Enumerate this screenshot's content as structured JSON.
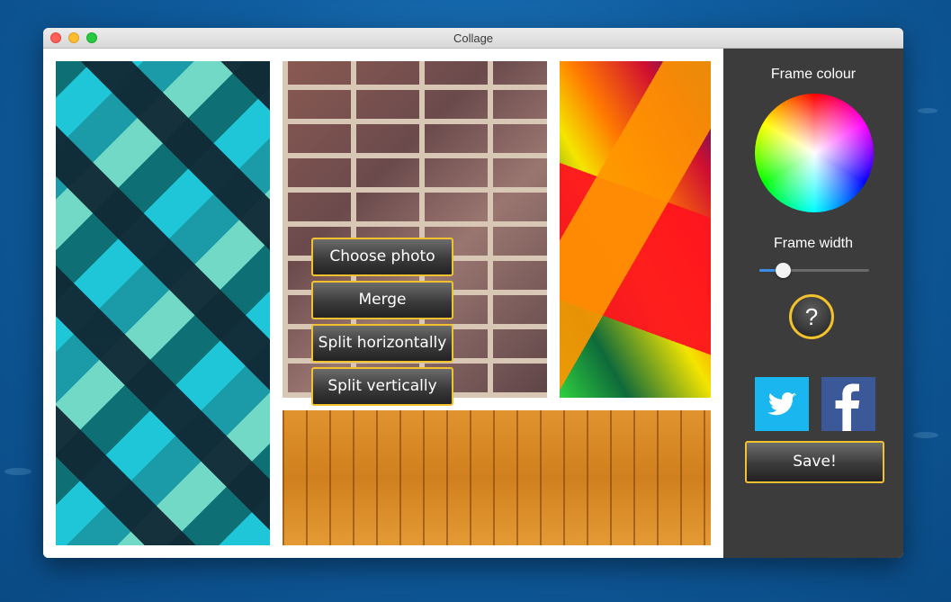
{
  "window": {
    "title": "Collage"
  },
  "menu": {
    "items": [
      "Choose photo",
      "Merge",
      "Split horizontally",
      "Split vertically"
    ]
  },
  "sidebar": {
    "frame_colour_label": "Frame colour",
    "frame_width_label": "Frame width",
    "frame_width_value_fraction": 0.22,
    "help_label": "?",
    "save_label": "Save!"
  },
  "colors": {
    "accent_border": "#f2c12e",
    "sidebar_bg": "#3c3c3c",
    "slider_fill": "#3a8ee6",
    "twitter": "#19b6f0",
    "facebook": "#3b5998"
  },
  "icons": [
    "twitter-icon",
    "facebook-icon",
    "help-icon",
    "color-wheel-icon"
  ]
}
